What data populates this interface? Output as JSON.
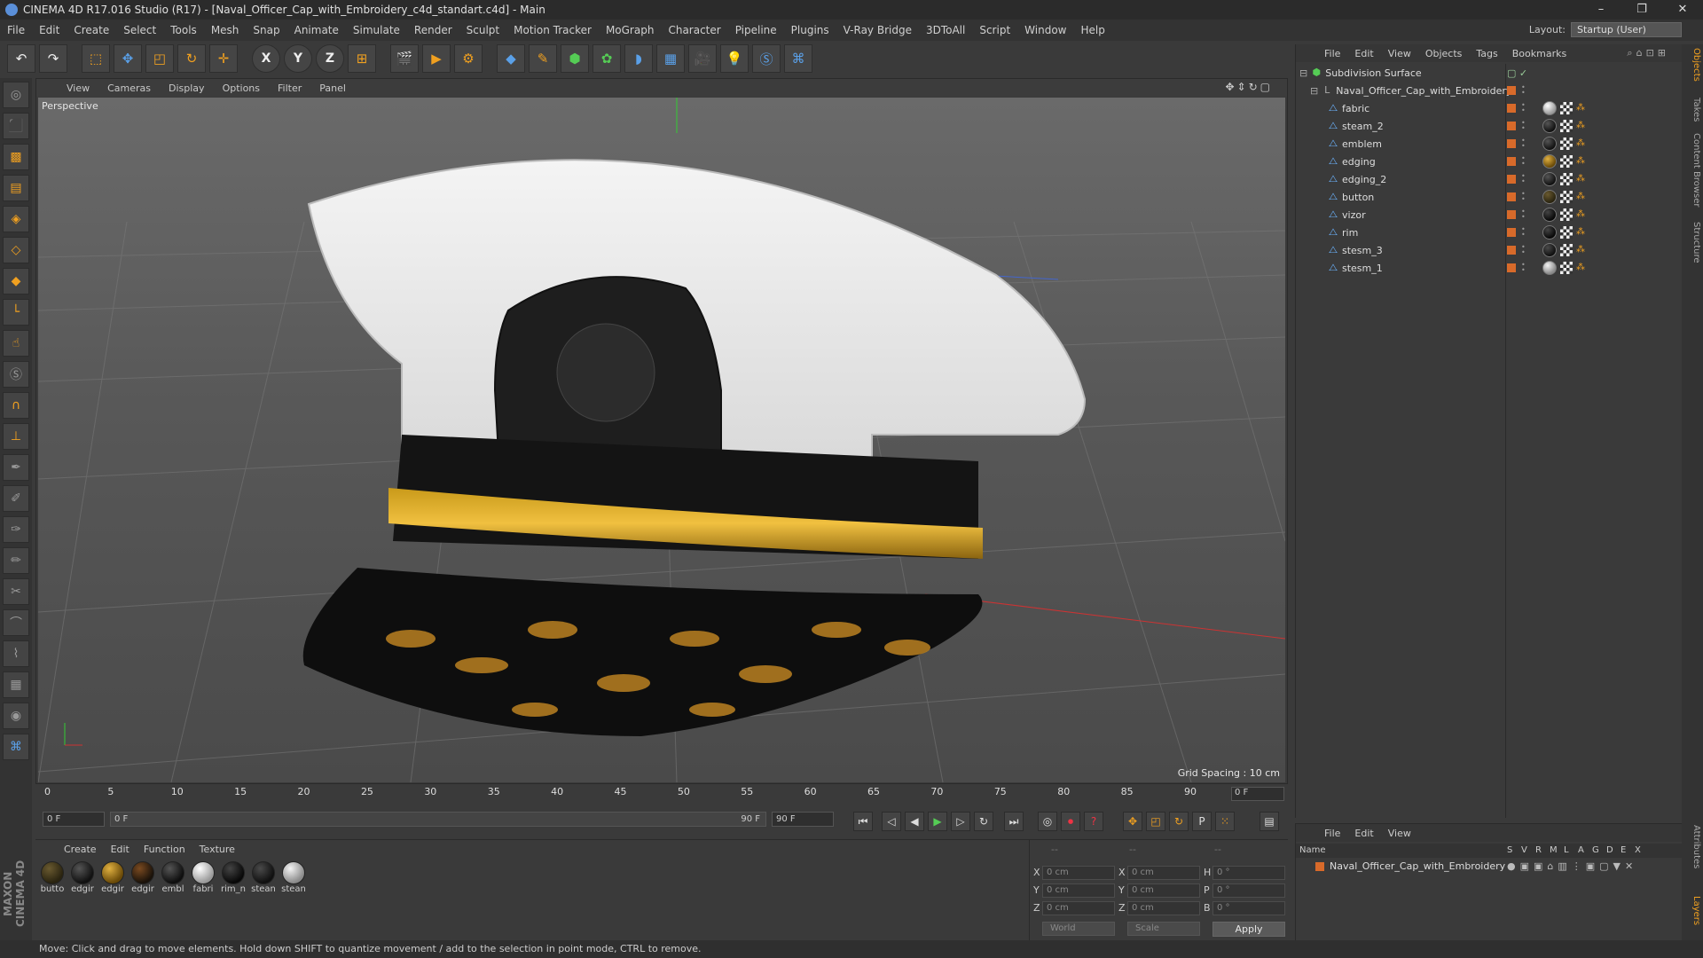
{
  "window": {
    "title": "CINEMA 4D R17.016 Studio (R17) - [Naval_Officer_Cap_with_Embroidery_c4d_standart.c4d] - Main",
    "controls": [
      "–",
      "❐",
      "✕"
    ]
  },
  "menubar": {
    "items": [
      "File",
      "Edit",
      "Create",
      "Select",
      "Tools",
      "Mesh",
      "Snap",
      "Animate",
      "Simulate",
      "Render",
      "Sculpt",
      "Motion Tracker",
      "MoGraph",
      "Character",
      "Pipeline",
      "Plugins",
      "V-Ray Bridge",
      "3DToAll",
      "Script",
      "Window",
      "Help"
    ],
    "layout_label": "Layout:",
    "layout_value": "Startup (User)"
  },
  "toolbar": {
    "axis_x": "X",
    "axis_y": "Y",
    "axis_z": "Z"
  },
  "viewport": {
    "menu": [
      "View",
      "Cameras",
      "Display",
      "Options",
      "Filter",
      "Panel"
    ],
    "camera_label": "Perspective",
    "grid_spacing": "Grid Spacing : 10 cm"
  },
  "timeline": {
    "ticks": [
      "0",
      "5",
      "10",
      "15",
      "20",
      "25",
      "30",
      "35",
      "40",
      "45",
      "50",
      "55",
      "60",
      "65",
      "70",
      "75",
      "80",
      "85",
      "90"
    ],
    "current_frame": "0 F"
  },
  "transport": {
    "start_field": "0 F",
    "range_start": "0 F",
    "range_end": "90 F",
    "end_field": "90 F"
  },
  "materials": {
    "menu": [
      "Create",
      "Edit",
      "Function",
      "Texture"
    ],
    "items": [
      {
        "name": "butto",
        "color": "#2a2410"
      },
      {
        "name": "edgir",
        "color": "#1a1a1a"
      },
      {
        "name": "edgir",
        "color": "#8a6a10"
      },
      {
        "name": "edgir",
        "color": "#221a10"
      },
      {
        "name": "embl",
        "color": "#151515"
      },
      {
        "name": "fabri",
        "color": "#d8d8d8"
      },
      {
        "name": "rim_n",
        "color": "#111111"
      },
      {
        "name": "stean",
        "color": "#181818"
      },
      {
        "name": "stean",
        "color": "#c8c8c8"
      }
    ]
  },
  "coordinates": {
    "header": [
      "--",
      "--",
      "--"
    ],
    "x_label": "X",
    "y_label": "Y",
    "z_label": "Z",
    "x_pos": "0 cm",
    "y_pos": "0 cm",
    "z_pos": "0 cm",
    "x_size": "0 cm",
    "y_size": "0 cm",
    "z_size": "0 cm",
    "h_label": "H",
    "p_label": "P",
    "b_label": "B",
    "h_rot": "0 °",
    "p_rot": "0 °",
    "b_rot": "0 °",
    "world": "World",
    "scale": "Scale",
    "apply": "Apply"
  },
  "object_manager": {
    "menu": [
      "File",
      "Edit",
      "View",
      "Objects",
      "Tags",
      "Bookmarks"
    ],
    "root": "Subdivision Surface",
    "group": "Naval_Officer_Cap_with_Embroidery",
    "objects": [
      {
        "name": "fabric",
        "tag_color": "#d0d0d0"
      },
      {
        "name": "steam_2",
        "tag_color": "#1a1a1a"
      },
      {
        "name": "emblem",
        "tag_color": "#1a1a1a"
      },
      {
        "name": "edging",
        "tag_color": "#8a6a10"
      },
      {
        "name": "edging_2",
        "tag_color": "#1a1a1a"
      },
      {
        "name": "button",
        "tag_color": "#3a3018"
      },
      {
        "name": "vizor",
        "tag_color": "#151515"
      },
      {
        "name": "rim",
        "tag_color": "#151515"
      },
      {
        "name": "stesm_3",
        "tag_color": "#1a1a1a"
      },
      {
        "name": "stesm_1",
        "tag_color": "#c8c8c8"
      }
    ]
  },
  "layer_manager": {
    "menu": [
      "File",
      "Edit",
      "View"
    ],
    "columns": [
      "Name",
      "S",
      "V",
      "R",
      "M",
      "L",
      "A",
      "G",
      "D",
      "E",
      "X"
    ],
    "layer": "Naval_Officer_Cap_with_Embroidery"
  },
  "side_tabs": [
    "Objects",
    "Takes",
    "Content Browser",
    "Structure",
    "Attributes",
    "Layers"
  ],
  "status": "Move: Click and drag to move elements. Hold down SHIFT to quantize movement / add to the selection in point mode, CTRL to remove.",
  "branding": "MAXON CINEMA 4D"
}
